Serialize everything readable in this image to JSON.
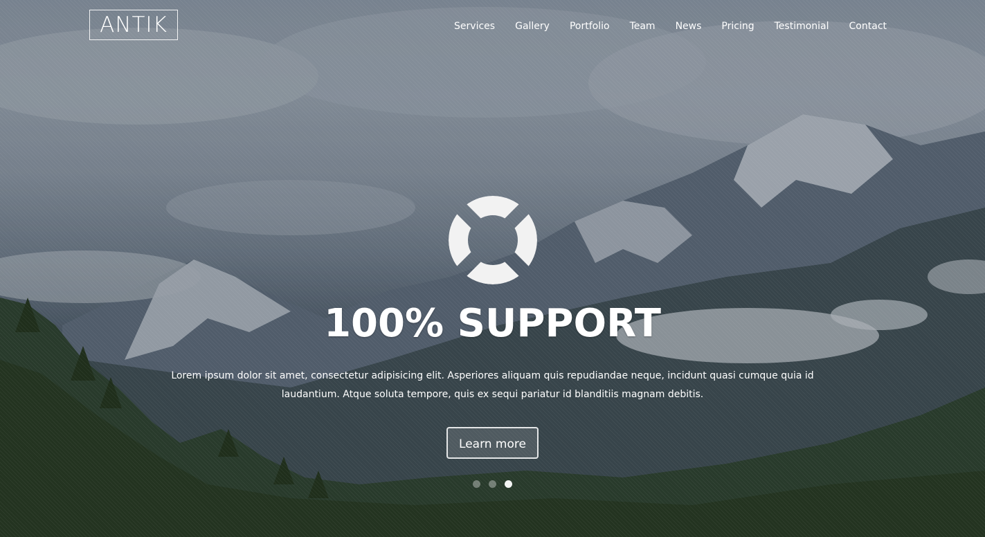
{
  "brand": {
    "logo_text": "ANTIK"
  },
  "nav": {
    "items": [
      {
        "label": "Services"
      },
      {
        "label": "Gallery"
      },
      {
        "label": "Portfolio"
      },
      {
        "label": "Team"
      },
      {
        "label": "News"
      },
      {
        "label": "Pricing"
      },
      {
        "label": "Testimonial"
      },
      {
        "label": "Contact"
      }
    ]
  },
  "hero": {
    "icon": "lifebuoy-icon",
    "headline": "100% SUPPORT",
    "description": "Lorem ipsum dolor sit amet, consectetur adipisicing elit. Asperiores aliquam quis repudiandae neque, incidunt quasi cumque quia id laudantium. Atque soluta tempore, quis ex sequi pariatur id blanditiis magnam debitis.",
    "cta_label": "Learn more"
  },
  "slider": {
    "total_slides": 3,
    "active_slide": 3
  },
  "colors": {
    "text": "#ffffff",
    "sky": "#8d99a6",
    "forest": "#2c3f2c"
  }
}
